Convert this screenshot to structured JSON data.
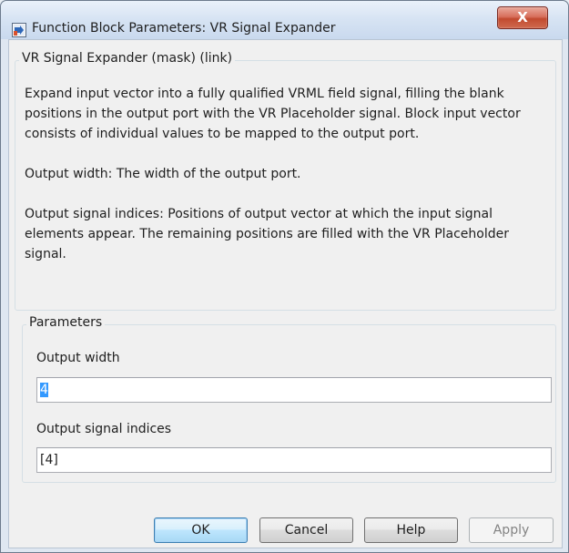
{
  "window": {
    "title": "Function Block Parameters: VR Signal Expander",
    "close_glyph": "X"
  },
  "description_group": {
    "legend": "VR Signal Expander (mask) (link)",
    "paragraphs": [
      "Expand input vector into a fully qualified VRML field signal, filling the blank positions in the output port with the VR Placeholder signal. Block input vector consists of individual values to be mapped to the output port.",
      "Output width: The width of the output port.",
      "Output signal indices: Positions of output vector at which the input signal elements appear. The remaining positions are filled with the VR Placeholder signal."
    ]
  },
  "parameters_group": {
    "legend": "Parameters",
    "output_width": {
      "label": "Output width",
      "value": "4"
    },
    "output_signal_indices": {
      "label": "Output signal indices",
      "value": "[4]"
    }
  },
  "buttons": {
    "ok": "OK",
    "cancel": "Cancel",
    "help": "Help",
    "apply": "Apply"
  }
}
